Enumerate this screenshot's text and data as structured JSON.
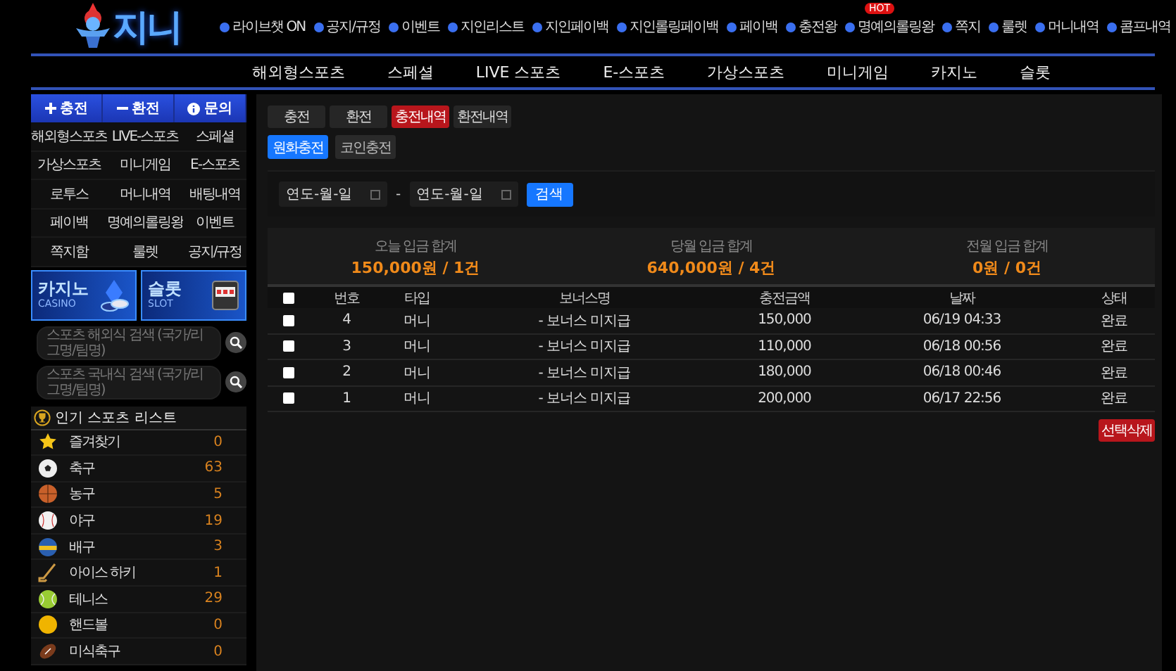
{
  "logo": {
    "text": "지니"
  },
  "top_links": [
    {
      "label": "라이브챗 ON"
    },
    {
      "label": "공지/규정"
    },
    {
      "label": "이벤트"
    },
    {
      "label": "지인리스트"
    },
    {
      "label": "지인페이백"
    },
    {
      "label": "지인롤링페이백"
    },
    {
      "label": "페이백"
    },
    {
      "label": "충전왕"
    },
    {
      "label": "명예의롤링왕",
      "badge": "HOT"
    },
    {
      "label": "쪽지"
    },
    {
      "label": "룰렛"
    },
    {
      "label": "머니내역"
    },
    {
      "label": "콤프내역"
    }
  ],
  "main_nav": [
    "해외형스포츠",
    "스페셜",
    "LIVE 스포츠",
    "E-스포츠",
    "가상스포츠",
    "미니게임",
    "카지노",
    "슬롯"
  ],
  "sidebar": {
    "actions": [
      {
        "kind": "plus",
        "label": "충전"
      },
      {
        "kind": "minus",
        "label": "환전"
      },
      {
        "kind": "info",
        "label": "문의"
      }
    ],
    "menu": [
      "해외형스포츠",
      "LIVE-스포츠",
      "스페셜",
      "가상스포츠",
      "미니게임",
      "E-스포츠",
      "로투스",
      "머니내역",
      "배팅내역",
      "페이백",
      "명예의롤링왕",
      "이벤트",
      "쪽지함",
      "룰렛",
      "공지/규정"
    ],
    "banners": [
      {
        "kind": "casino",
        "title": "카지노",
        "subtitle": "CASINO"
      },
      {
        "kind": "slot",
        "title": "슬롯",
        "subtitle": "SLOT"
      }
    ],
    "searches": [
      {
        "placeholder": "스포츠 해외식 검색 (국가/리그명/팀명)"
      },
      {
        "placeholder": "스포츠 국내식 검색 (국가/리그명/팀명)"
      }
    ],
    "sports_title": "인기 스포츠 리스트",
    "sports": [
      {
        "kind": "star",
        "name": "즐겨찾기",
        "count": "0"
      },
      {
        "kind": "soccer",
        "name": "축구",
        "count": "63"
      },
      {
        "kind": "basketball",
        "name": "농구",
        "count": "5"
      },
      {
        "kind": "baseball",
        "name": "야구",
        "count": "19"
      },
      {
        "kind": "volleyball",
        "name": "배구",
        "count": "3"
      },
      {
        "kind": "hockey",
        "name": "아이스 하키",
        "count": "1"
      },
      {
        "kind": "tennis",
        "name": "테니스",
        "count": "29"
      },
      {
        "kind": "handball",
        "name": "핸드볼",
        "count": "0"
      },
      {
        "kind": "football",
        "name": "미식축구",
        "count": "0"
      }
    ]
  },
  "tabs": [
    {
      "label": "충전",
      "selected": false
    },
    {
      "label": "환전",
      "selected": false
    },
    {
      "label": "충전내역",
      "selected": true
    },
    {
      "label": "환전내역",
      "selected": false
    }
  ],
  "sub_tabs": [
    {
      "label": "원화충전",
      "selected": true
    },
    {
      "label": "코인충전",
      "selected": false
    }
  ],
  "filter": {
    "from": {
      "placeholder": "연도-월-일"
    },
    "separator": "-",
    "to": {
      "placeholder": "연도-월-일"
    },
    "button": "검색"
  },
  "summary": [
    {
      "label": "오늘 입금 합계",
      "value": "150,000원 / 1건"
    },
    {
      "label": "당월 입금 합계",
      "value": "640,000원 / 4건"
    },
    {
      "label": "전월 입금 합계",
      "value": "0원 / 0건"
    }
  ],
  "table": {
    "select_all": {
      "checked": false
    },
    "columns": [
      "번호",
      "타입",
      "보너스명",
      "충전금액",
      "날짜",
      "상태"
    ],
    "rows": [
      {
        "checked": false,
        "cells": [
          "4",
          "머니",
          "- 보너스 미지급",
          "150,000",
          "06/19 04:33",
          "완료"
        ]
      },
      {
        "checked": false,
        "cells": [
          "3",
          "머니",
          "- 보너스 미지급",
          "110,000",
          "06/18 00:56",
          "완료"
        ]
      },
      {
        "checked": false,
        "cells": [
          "2",
          "머니",
          "- 보너스 미지급",
          "180,000",
          "06/18 00:46",
          "완료"
        ]
      },
      {
        "checked": false,
        "cells": [
          "1",
          "머니",
          "- 보너스 미지급",
          "200,000",
          "06/17 22:56",
          "완료"
        ]
      }
    ]
  },
  "delete_button": "선택삭제"
}
